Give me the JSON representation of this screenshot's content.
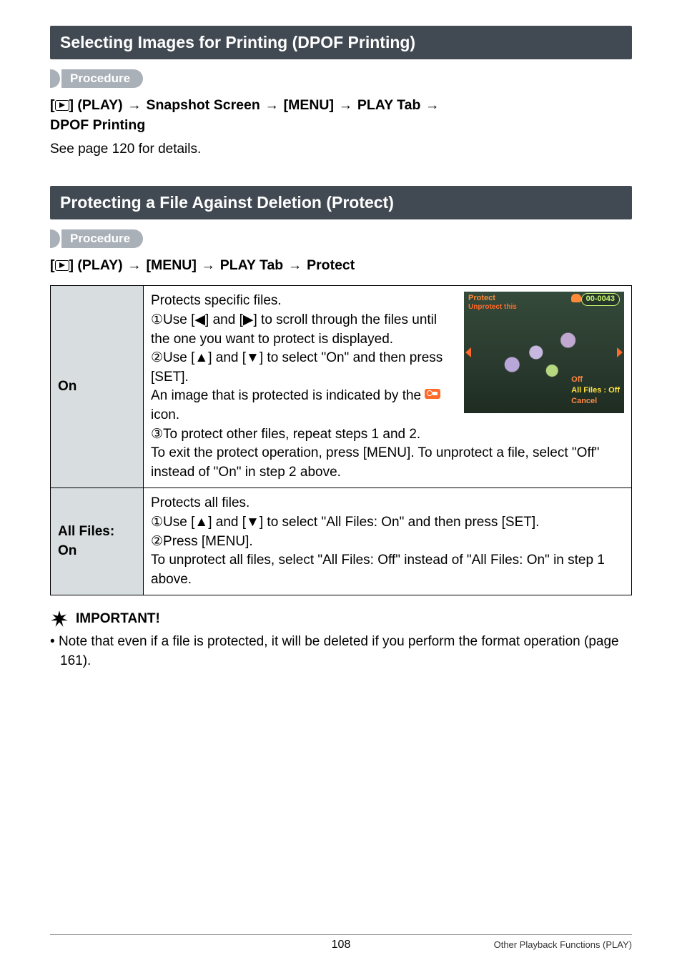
{
  "section1": {
    "title": "Selecting Images for Printing (DPOF Printing)",
    "procedure_label": "Procedure",
    "breadcrumb_prefix": "[",
    "breadcrumb_play": "] (PLAY)",
    "bc_part2": "Snapshot Screen",
    "bc_part3": "[MENU]",
    "bc_part4": "PLAY Tab",
    "bc_part5": "DPOF Printing",
    "body": "See page 120 for details."
  },
  "section2": {
    "title": "Protecting a File Against Deletion (Protect)",
    "procedure_label": "Procedure",
    "breadcrumb_play": "] (PLAY)",
    "bc_part2": "[MENU]",
    "bc_part3": "PLAY Tab",
    "bc_part4": "Protect"
  },
  "table": {
    "row1": {
      "label": "On",
      "line1": "Protects specific files.",
      "step1a": "Use [",
      "step1b": "] and [",
      "step1c": "] to scroll through the files until the one you want to protect is displayed.",
      "step2a": "Use [",
      "step2b": "] and [",
      "step2c": "] to select \"On\" and then press [SET].",
      "line_icon_a": "An image that is protected is indicated by the ",
      "line_icon_b": " icon.",
      "step3": "To protect other files, repeat steps 1 and 2.",
      "tail": "To exit the protect operation, press [MENU]. To unprotect a file, select \"Off\" instead of \"On\" in step 2 above."
    },
    "row2": {
      "label": "All Files: On",
      "line1": "Protects all files.",
      "step1a": "Use [",
      "step1b": "] and [",
      "step1c": "] to select \"All Files: On\" and then press [SET].",
      "step2": "Press [MENU].",
      "tail": "To unprotect all files, select \"All Files: Off\" instead of \"All Files: On\" in step 1 above."
    }
  },
  "thumb": {
    "title": "Protect",
    "subtitle": "Unprotect this",
    "counter": "00-0043",
    "menu1": "Off",
    "menu2": "All Files : Off",
    "menu3": "Cancel"
  },
  "important": {
    "label": "IMPORTANT!",
    "note": "Note that even if a file is protected, it will be deleted if you perform the format operation (page 161)."
  },
  "glyphs": {
    "arrow": "→",
    "left": "◀",
    "right": "▶",
    "up": "▲",
    "down": "▼",
    "c1": "①",
    "c2": "②",
    "c3": "③"
  },
  "footer": {
    "page": "108",
    "chapter": "Other Playback Functions (PLAY)"
  }
}
